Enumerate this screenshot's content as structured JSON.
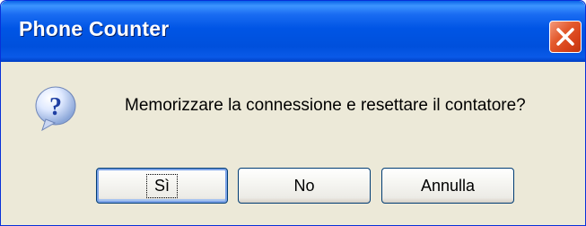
{
  "window": {
    "title": "Phone Counter"
  },
  "dialog": {
    "icon": "question-icon",
    "message": "Memorizzare la connessione e resettare il contatore?"
  },
  "buttons": {
    "yes_label": "Sì",
    "no_label": "No",
    "cancel_label": "Annulla"
  },
  "colors": {
    "titlebar": "#0055e5",
    "close_button": "#d8431a",
    "dialog_background": "#ece9d8"
  }
}
